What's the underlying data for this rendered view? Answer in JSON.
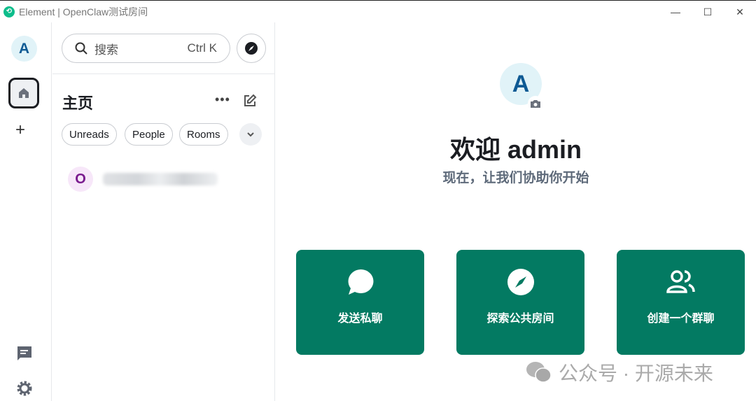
{
  "window": {
    "title": "Element | OpenClaw测试房间"
  },
  "rail": {
    "avatar_letter": "A"
  },
  "list": {
    "search_placeholder": "搜索",
    "search_shortcut": "Ctrl K",
    "heading": "主页",
    "more": "•••",
    "filters": [
      "Unreads",
      "People",
      "Rooms"
    ],
    "rooms": [
      {
        "avatar_letter": "O"
      }
    ]
  },
  "main": {
    "avatar_letter": "A",
    "welcome": "欢迎 admin",
    "subtitle": "现在，让我们协助你开始",
    "cards": [
      {
        "label": "发送私聊",
        "icon": "chat-bubble-icon"
      },
      {
        "label": "探索公共房间",
        "icon": "compass-icon"
      },
      {
        "label": "创建一个群聊",
        "icon": "group-icon"
      }
    ]
  },
  "watermark": "公众号 · 开源未来",
  "colors": {
    "accent": "#037a62",
    "brand": "#0dbd8b"
  }
}
